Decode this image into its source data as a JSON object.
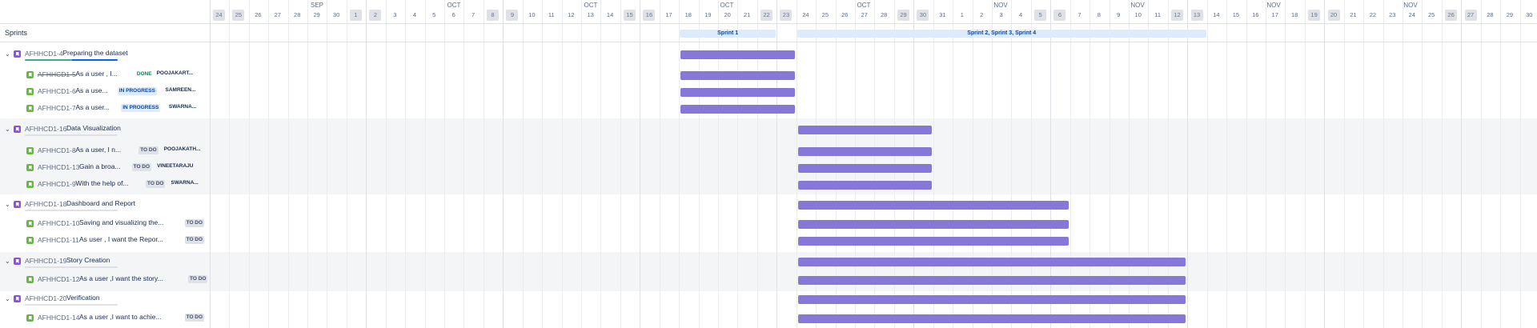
{
  "header": {
    "months": [
      "SEP",
      "OCT",
      "OCT",
      "OCT",
      "OCT",
      "NOV",
      "NOV",
      "NOV",
      "NOV"
    ],
    "days": [
      24,
      25,
      26,
      27,
      28,
      29,
      30,
      1,
      2,
      3,
      4,
      5,
      6,
      7,
      8,
      9,
      10,
      11,
      12,
      13,
      14,
      15,
      16,
      17,
      18,
      19,
      20,
      21,
      22,
      23,
      24,
      25,
      26,
      27,
      28,
      29,
      30,
      31,
      1,
      2,
      3,
      4,
      5,
      6,
      7,
      8,
      9,
      10,
      11,
      12,
      13,
      14,
      15,
      16,
      17,
      18,
      19,
      20,
      21,
      22,
      23,
      24,
      25,
      26,
      27,
      28,
      29,
      30
    ],
    "weekend_days": [
      24,
      25,
      1,
      2,
      8,
      9,
      15,
      16,
      22,
      23,
      29,
      30,
      5,
      6,
      12,
      13,
      19,
      20,
      26,
      27
    ]
  },
  "sprints": {
    "label": "Sprints",
    "items": [
      {
        "label": "Sprint 1"
      },
      {
        "label": "Sprint 2, Sprint 3, Sprint 4"
      }
    ]
  },
  "rows": [
    {
      "type": "epic",
      "key": "AFHHCD1-4",
      "summary": "Preparing the dataset",
      "progress_done": 0.5,
      "progress_inprogress": 0.5
    },
    {
      "type": "story",
      "key": "AFHHCD1-5",
      "summary": "As a user , I...",
      "status": "DONE",
      "status_kind": "done",
      "assignee": "POOJAKART...",
      "key_done": true
    },
    {
      "type": "story",
      "key": "AFHHCD1-6",
      "summary": "As a use...",
      "status": "IN PROGRESS",
      "status_kind": "prog",
      "assignee": "SAMREEN..."
    },
    {
      "type": "story",
      "key": "AFHHCD1-7",
      "summary": "As a user...",
      "status": "IN PROGRESS",
      "status_kind": "prog",
      "assignee": "SWARNA..."
    },
    {
      "type": "epic",
      "key": "AFHHCD1-16",
      "summary": "Data Visualization",
      "progress_done": 0,
      "progress_inprogress": 0
    },
    {
      "type": "story",
      "key": "AFHHCD1-8",
      "summary": "As a user, I n...",
      "status": "TO DO",
      "status_kind": "todo",
      "assignee": "POOJAKATH..."
    },
    {
      "type": "story",
      "key": "AFHHCD1-13",
      "summary": "Gain a broa...",
      "status": "TO DO",
      "status_kind": "todo",
      "assignee": "VINEETARAJU"
    },
    {
      "type": "story",
      "key": "AFHHCD1-9",
      "summary": "With the help of...",
      "status": "TO DO",
      "status_kind": "todo",
      "assignee": "SWARNA..."
    },
    {
      "type": "epic",
      "key": "AFHHCD1-18",
      "summary": "Dashboard and Report",
      "progress_done": 0,
      "progress_inprogress": 0
    },
    {
      "type": "story",
      "key": "AFHHCD1-10",
      "summary": "Saving and visualizing the...",
      "status": "TO DO",
      "status_kind": "todo",
      "assignee": ""
    },
    {
      "type": "story",
      "key": "AFHHCD1-11",
      "summary": "As user , I want the Repor...",
      "status": "TO DO",
      "status_kind": "todo",
      "assignee": ""
    },
    {
      "type": "epic",
      "key": "AFHHCD1-19",
      "summary": "Story Creation",
      "progress_done": 0,
      "progress_inprogress": 0
    },
    {
      "type": "story",
      "key": "AFHHCD1-12",
      "summary": "As a user ,I want the story...",
      "status": "TO DO",
      "status_kind": "todo",
      "assignee": ""
    },
    {
      "type": "epic",
      "key": "AFHHCD1-20",
      "summary": "Verification",
      "progress_done": 0,
      "progress_inprogress": 0
    },
    {
      "type": "story",
      "key": "AFHHCD1-14",
      "summary": "As a user ,I want to achie...",
      "status": "TO DO",
      "status_kind": "todo",
      "assignee": ""
    }
  ],
  "colors": {
    "bar": "#8777d9",
    "epic_icon": "#904ee2",
    "story_icon": "#63ba3c",
    "sprint": "#deebff"
  },
  "icons": {
    "expand": "chevron-down-icon",
    "epic": "epic-icon",
    "story": "story-icon"
  }
}
